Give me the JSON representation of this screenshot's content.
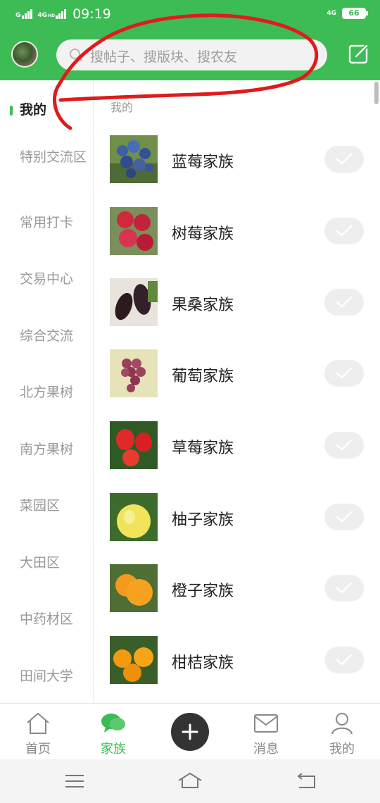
{
  "status": {
    "net_left": "G",
    "net_mid": "4G",
    "hd": "HD",
    "time": "09:19",
    "net_right": "4G",
    "battery": "66"
  },
  "header": {
    "search_placeholder": "搜帖子、搜版块、搜农友"
  },
  "sidebar": {
    "items": [
      {
        "label": "我的",
        "active": true
      },
      {
        "label": "特别交流区"
      },
      {
        "label": "常用打卡"
      },
      {
        "label": "交易中心"
      },
      {
        "label": "综合交流"
      },
      {
        "label": "北方果树"
      },
      {
        "label": "南方果树"
      },
      {
        "label": "菜园区"
      },
      {
        "label": "大田区"
      },
      {
        "label": "中药材区"
      },
      {
        "label": "田间大学"
      }
    ]
  },
  "main": {
    "section_title": "我的",
    "families": [
      {
        "name": "蓝莓家族",
        "icon": "blueberry-image"
      },
      {
        "name": "树莓家族",
        "icon": "raspberry-image"
      },
      {
        "name": "果桑家族",
        "icon": "mulberry-image"
      },
      {
        "name": "葡萄家族",
        "icon": "grape-image"
      },
      {
        "name": "草莓家族",
        "icon": "strawberry-image"
      },
      {
        "name": "柚子家族",
        "icon": "pomelo-image"
      },
      {
        "name": "橙子家族",
        "icon": "orange-image"
      },
      {
        "name": "柑桔家族",
        "icon": "tangerine-image"
      }
    ]
  },
  "tabbar": {
    "items": [
      {
        "label": "首页"
      },
      {
        "label": "家族",
        "active": true
      },
      {
        "label": "消息"
      },
      {
        "label": "我的"
      }
    ]
  },
  "colors": {
    "brand": "#3dbb54",
    "annotation": "#e01b1b"
  }
}
